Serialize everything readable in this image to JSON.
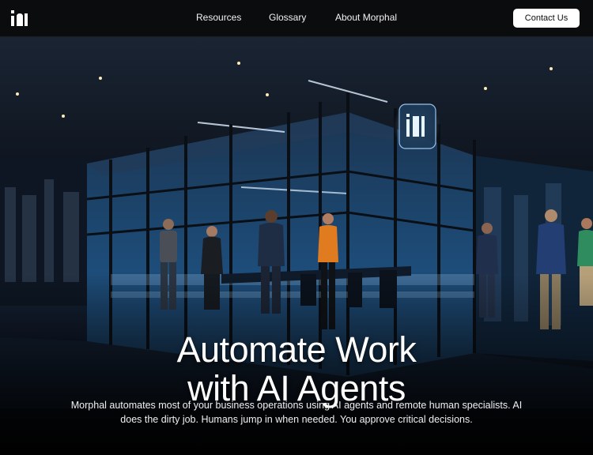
{
  "brand": {
    "logo_icon": "morphal-logo-icon"
  },
  "nav": {
    "links": [
      {
        "label": "Resources"
      },
      {
        "label": "Glossary"
      },
      {
        "label": "About Morphal"
      }
    ],
    "contact_label": "Contact Us"
  },
  "hero": {
    "image": "office-glass-wall-illustration",
    "headline_line1": "Automate Work",
    "headline_line2": "with AI Agents",
    "subtext": "Morphal automates most of your business operations using AI agents and remote human specialists. AI does the dirty job. Humans jump in when needed. You approve critical decisions."
  },
  "colors": {
    "background": "#050608",
    "topbar": "#0b0c0e",
    "button_bg": "#ffffff",
    "text": "#ffffff",
    "glass_blue": "#1e4a78"
  }
}
